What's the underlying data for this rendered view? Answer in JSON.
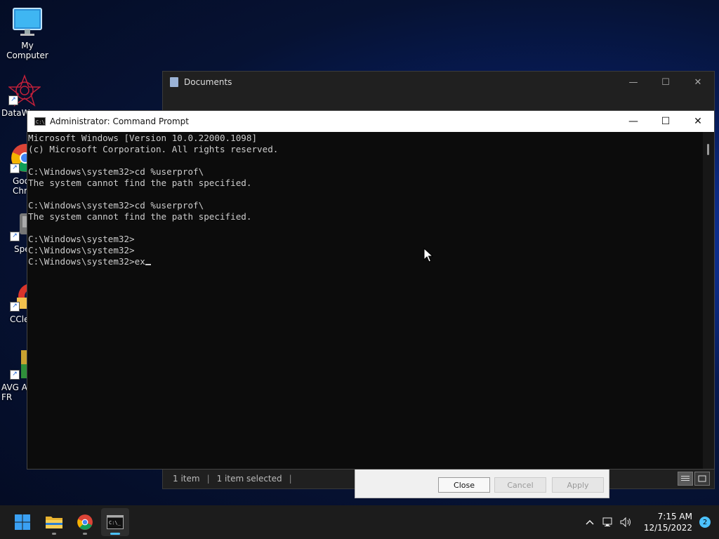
{
  "desktop": {
    "icons": [
      {
        "label": "My Computer"
      },
      {
        "label": "DataW"
      },
      {
        "label": "Goo\nChro"
      },
      {
        "label": "Spe"
      },
      {
        "label": "CCle"
      },
      {
        "label": "AVG An\nFR"
      }
    ]
  },
  "explorer": {
    "title": "Documents",
    "status_items": "1 item",
    "status_selected": "1 item selected",
    "sep": "|"
  },
  "dialog": {
    "close_label": "Close",
    "cancel_label": "Cancel",
    "apply_label": "Apply"
  },
  "cmd": {
    "title": "Administrator: Command Prompt",
    "icon_text": "C:\\",
    "lines": [
      "Microsoft Windows [Version 10.0.22000.1098]",
      "(c) Microsoft Corporation. All rights reserved.",
      "",
      "C:\\Windows\\system32>cd %userprof\\",
      "The system cannot find the path specified.",
      "",
      "C:\\Windows\\system32>cd %userprof\\",
      "The system cannot find the path specified.",
      "",
      "C:\\Windows\\system32>",
      "C:\\Windows\\system32>",
      "C:\\Windows\\system32>ex"
    ]
  },
  "taskbar": {
    "apps": [
      {
        "icon": "windows-start-icon"
      },
      {
        "icon": "file-explorer-icon"
      },
      {
        "icon": "chrome-icon"
      },
      {
        "icon": "terminal-icon"
      }
    ],
    "time": "7:15 AM",
    "date": "12/15/2022",
    "notification_count": "2"
  },
  "colors": {
    "accent": "#4cc2ff",
    "console_bg": "#0c0c0c",
    "console_fg": "#cccccc",
    "taskbar_bg": "#1c1c1c"
  }
}
